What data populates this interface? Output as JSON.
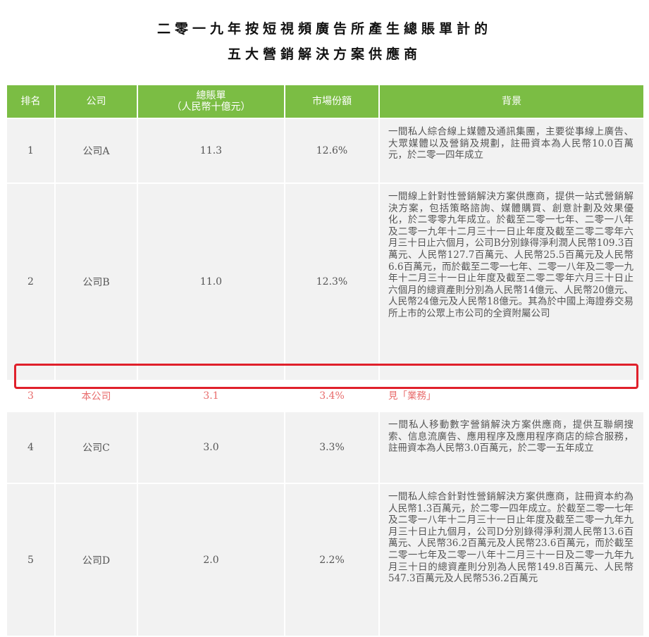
{
  "title": {
    "line1": "二零一九年按短視頻廣告所產生總賬單計的",
    "line2": "五大營銷解決方案供應商"
  },
  "table": {
    "headers": {
      "rank": "排名",
      "company": "公司",
      "billing_line1": "總賬單",
      "billing_line2": "（人民幣十億元）",
      "share": "市場份額",
      "background": "背景"
    },
    "rows": [
      {
        "rank": "1",
        "company": "公司A",
        "billing": "11.3",
        "share": "12.6%",
        "background": "一間私人綜合線上媒體及通訊集團，主要從事線上廣告、大眾媒體以及營銷及規劃，註冊資本為人民幣10.0百萬元，於二零一四年成立"
      },
      {
        "rank": "2",
        "company": "公司B",
        "billing": "11.0",
        "share": "12.3%",
        "background": "一間線上針對性營銷解決方案供應商，提供一站式營銷解決方案，包括策略諮詢、媒體購買、創意計劃及效果優化，於二零零九年成立。於截至二零一七年、二零一八年及二零一九年十二月三十一日止年度及截至二零二零年六月三十日止六個月，公司B分別錄得淨利潤人民幣109.3百萬元、人民幣127.7百萬元、人民幣25.5百萬元及人民幣6.6百萬元，而於截至二零一七年、二零一八年及二零一九年十二月三十一日止年度及截至二零二零年六月三十日止六個月的總資產則分別為人民幣14億元、人民幣20億元、人民幣24億元及人民幣18億元。其為於中國上海證券交易所上市的公眾上市公司的全資附屬公司"
      },
      {
        "rank": "3",
        "company": "本公司",
        "billing": "3.1",
        "share": "3.4%",
        "background": "見「業務」"
      },
      {
        "rank": "4",
        "company": "公司C",
        "billing": "3.0",
        "share": "3.3%",
        "background": "一間私人移動數字營銷解決方案供應商，提供互聯網搜索、信息流廣告、應用程序及應用程序商店的綜合服務，註冊資本為人民幣3.0百萬元，於二零一五年成立"
      },
      {
        "rank": "5",
        "company": "公司D",
        "billing": "2.0",
        "share": "2.2%",
        "background": "一間私人綜合針對性營銷解決方案供應商，註冊資本約為人民幣1.3百萬元，於二零一四年成立。於截至二零一七年及二零一八年十二月三十一日止年度及截至二零一九年九月三十日止九個月，公司D分別錄得淨利潤人民幣13.6百萬元、人民幣36.2百萬元及人民幣23.6百萬元，而於截至二零一七年及二零一八年十二月三十一日及二零一九年九月三十日的總資產則分別為人民幣149.8百萬元、人民幣547.3百萬元及人民幣536.2百萬元"
      }
    ]
  },
  "colors": {
    "header_bg": "#7bbd44",
    "cell_bg": "#f2f2f2",
    "highlight_border": "#e0202b",
    "highlight_text": "#e86b6b"
  }
}
